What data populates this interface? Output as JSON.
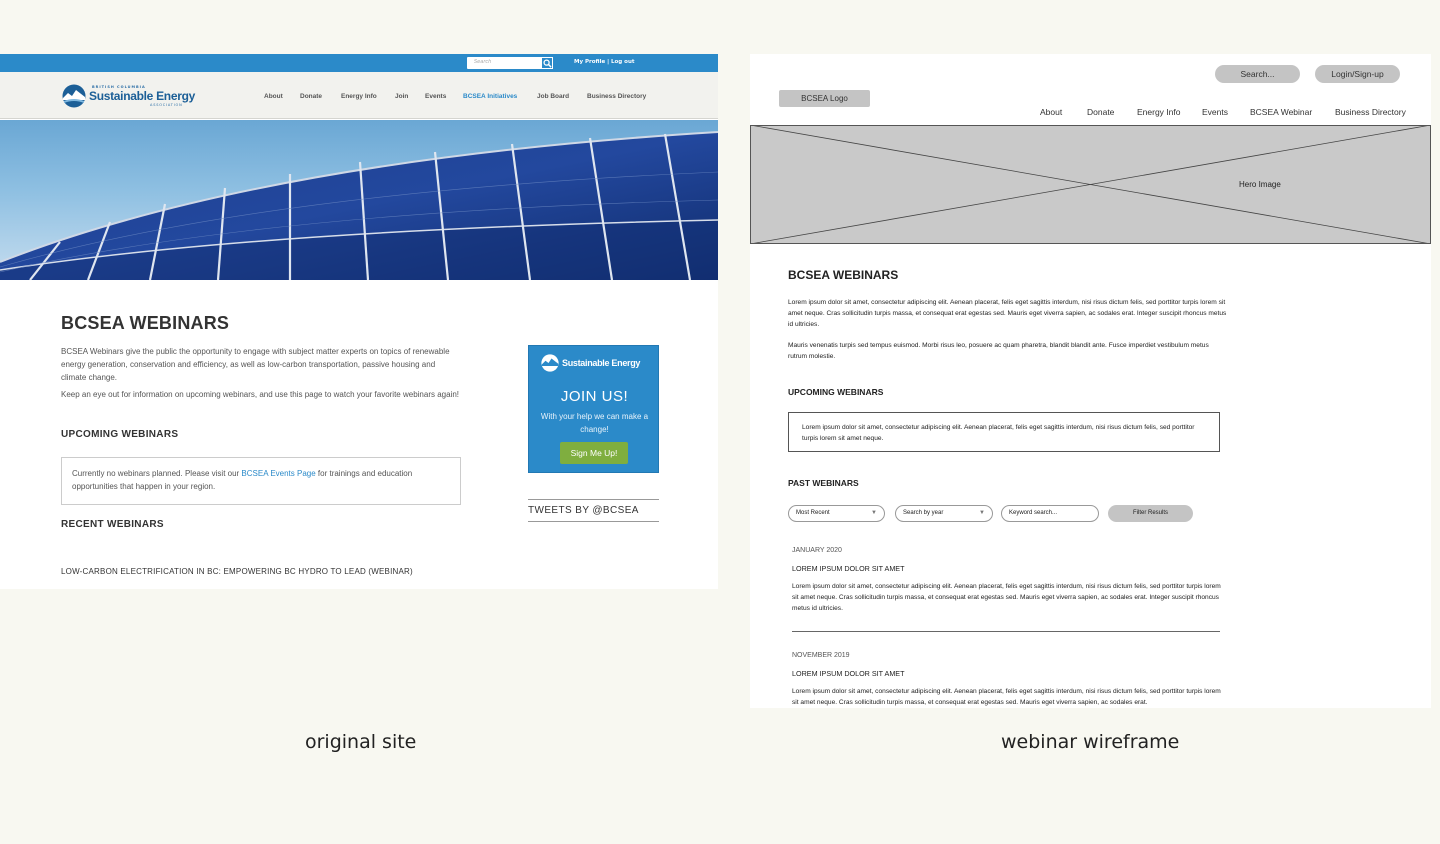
{
  "original": {
    "search_placeholder": "Search",
    "profile_links": "My Profile | Log out",
    "logo": {
      "top": "BRITISH COLUMBIA",
      "main": "Sustainable Energy",
      "sub": "ASSOCIATION"
    },
    "nav": [
      "About",
      "Donate",
      "Energy Info",
      "Join",
      "Events",
      "BCSEA Initiatives",
      "Job Board",
      "Business Directory"
    ],
    "nav_active_index": 5,
    "title": "BCSEA WEBINARS",
    "intro": "BCSEA Webinars give the public the opportunity to engage with subject matter experts on topics of renewable energy generation, conservation and efficiency, as well as low-carbon transportation, passive housing and climate change.",
    "intro2": "Keep an eye out for information on upcoming webinars, and use this page to watch your favorite webinars again!",
    "upcoming_heading": "UPCOMING WEBINARS",
    "upcoming_box_pre": "Currently no webinars planned. Please visit our ",
    "upcoming_box_link": "BCSEA Events Page",
    "upcoming_box_post": " for trainings and education opportunities that happen in your region.",
    "recent_heading": "RECENT WEBINARS",
    "recent_item": "LOW-CARBON ELECTRIFICATION IN BC: EMPOWERING BC HYDRO TO LEAD (WEBINAR)",
    "join": {
      "logo_text": "Sustainable Energy",
      "title": "JOIN US!",
      "subtitle": "With your help we can make a change!",
      "button": "Sign Me Up!"
    },
    "tweets": "TWEETS BY @BCSEA"
  },
  "wireframe": {
    "search": "Search...",
    "login": "Login/Sign-up",
    "logo": "BCSEA Logo",
    "nav": [
      "About",
      "Donate",
      "Energy Info",
      "Events",
      "BCSEA Webinar",
      "Business Directory"
    ],
    "hero_label": "Hero Image",
    "title": "BCSEA WEBINARS",
    "para1": "Lorem ipsum dolor sit amet, consectetur adipiscing elit. Aenean placerat, felis eget sagittis interdum, nisi risus dictum felis, sed porttitor turpis lorem sit amet neque. Cras sollicitudin turpis massa, et consequat erat egestas sed. Mauris eget viverra sapien, ac sodales erat. Integer suscipit rhoncus metus id ultricies.",
    "para2": "Mauris venenatis turpis sed tempus euismod. Morbi risus leo, posuere ac quam pharetra, blandit blandit ante. Fusce imperdiet vestibulum metus rutrum molestie.",
    "upcoming_heading": "UPCOMING WEBINARS",
    "upcoming_box": "Lorem ipsum dolor sit amet, consectetur adipiscing elit. Aenean placerat, felis eget sagittis interdum, nisi risus dictum felis, sed porttitor turpis lorem sit amet neque.",
    "past_heading": "PAST WEBINARS",
    "filter_sort": "Most Recent",
    "filter_year": "Search by year",
    "filter_keyword": "Keyword search...",
    "filter_button": "Filter Results",
    "entries": [
      {
        "date": "JANUARY 2020",
        "title": "LOREM IPSUM DOLOR SIT AMET",
        "body": "Lorem ipsum dolor sit amet, consectetur adipiscing elit. Aenean placerat, felis eget sagittis interdum, nisi risus dictum felis, sed porttitor turpis lorem sit amet neque. Cras sollicitudin turpis massa, et consequat erat egestas sed. Mauris eget viverra sapien, ac sodales erat. Integer suscipit rhoncus metus id ultricies."
      },
      {
        "date": "NOVEMBER 2019",
        "title": "LOREM IPSUM DOLOR SIT AMET",
        "body": "Lorem ipsum dolor sit amet, consectetur adipiscing elit. Aenean placerat, felis eget sagittis interdum, nisi risus dictum felis, sed porttitor turpis lorem sit amet neque. Cras sollicitudin turpis massa, et consequat erat egestas sed. Mauris eget viverra sapien, ac sodales erat."
      }
    ]
  },
  "captions": {
    "left": "original site",
    "right": "webinar wireframe"
  },
  "colors": {
    "brand_blue": "#2b8ac9",
    "join_button_green": "#7fae3f",
    "wireframe_gray": "#c4c4c4"
  }
}
